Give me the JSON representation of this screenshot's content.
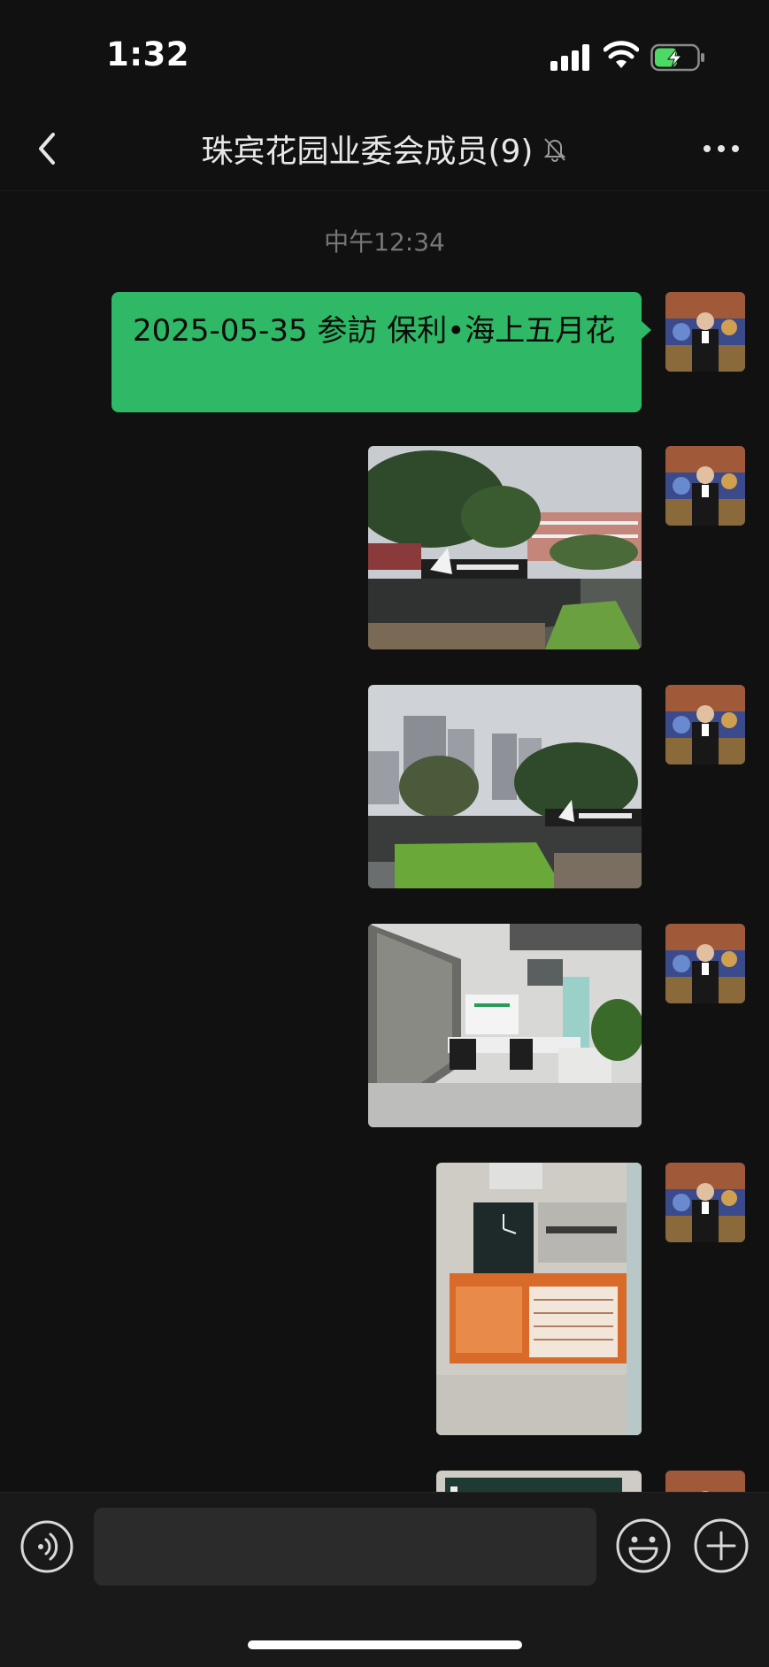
{
  "status_bar": {
    "time": "1:32",
    "signal_icon": "cellular-signal-icon",
    "wifi_icon": "wifi-icon",
    "battery_icon": "battery-charging-icon",
    "battery_level": 0.55,
    "battery_color": "#4cd964"
  },
  "nav": {
    "back_icon": "chevron-left-icon",
    "title": "珠宾花园业委会成员(9)",
    "mute_icon": "bell-muted-icon",
    "more_icon": "more-horizontal-icon"
  },
  "chat": {
    "timestamp": "中午12:34",
    "messages": [
      {
        "type": "text",
        "sender": "self",
        "text": "2025-05-35 参訪 保利•海上五月花"
      },
      {
        "type": "image",
        "sender": "self",
        "description_icon": "photo-plaza-sign"
      },
      {
        "type": "image",
        "sender": "self",
        "description_icon": "photo-plaza-towers"
      },
      {
        "type": "image",
        "sender": "self",
        "description_icon": "photo-office-interior"
      },
      {
        "type": "image",
        "sender": "self",
        "description_icon": "photo-service-center-wall"
      },
      {
        "type": "image",
        "sender": "self",
        "description_icon": "photo-partial"
      }
    ],
    "bubble_color": "#2fb865"
  },
  "input_bar": {
    "voice_icon": "voice-input-icon",
    "input_value": "",
    "emoji_icon": "emoji-icon",
    "add_icon": "plus-circle-icon"
  }
}
